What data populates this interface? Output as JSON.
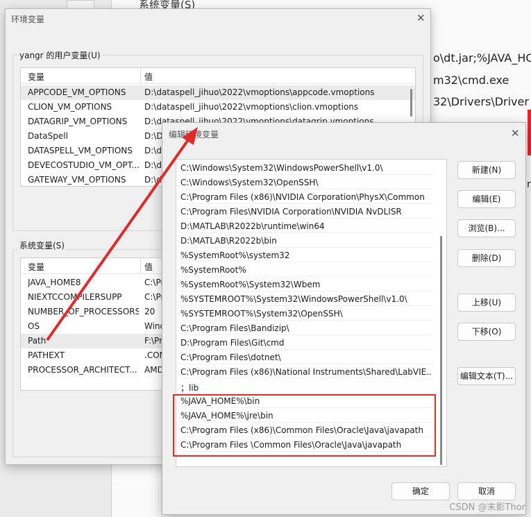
{
  "background": {
    "title": "系统变量(S)",
    "lines": [
      "o\\dt.jar;%JAVA_HO",
      "m32\\cmd.exe",
      "32\\Drivers\\Driver"
    ],
    "side_text": "ru"
  },
  "outer_dialog": {
    "title": "环境变量",
    "user_group_label": "yangr 的用户变量(U)",
    "columns": [
      "变量",
      "值"
    ],
    "user_vars": [
      {
        "name": "APPCODE_VM_OPTIONS",
        "value": "D:\\dataspell_jihuo\\2022\\vmoptions\\appcode.vmoptions"
      },
      {
        "name": "CLION_VM_OPTIONS",
        "value": "D:\\dataspell_jihuo\\2022\\vmoptions\\clion.vmoptions"
      },
      {
        "name": "DATAGRIP_VM_OPTIONS",
        "value": "D:\\dataspell_jihuo\\2022\\vmoptions\\datagrip.vmoptions"
      },
      {
        "name": "DataSpell",
        "value": "D:\\D"
      },
      {
        "name": "DATASPELL_VM_OPTIONS",
        "value": "D:\\d"
      },
      {
        "name": "DEVECOSTUDIO_VM_OPT...",
        "value": "D:\\d"
      },
      {
        "name": "GATEWAY_VM_OPTIONS",
        "value": "D:\\d"
      }
    ],
    "system_group_label": "系统变量(S)",
    "system_vars": [
      {
        "name": "JAVA_HOME8",
        "value": "C:\\Pr"
      },
      {
        "name": "NIEXTCCOMPILERSUPP",
        "value": "C:\\Pr"
      },
      {
        "name": "NUMBER_OF_PROCESSORS",
        "value": "20"
      },
      {
        "name": "OS",
        "value": "Wind"
      },
      {
        "name": "Path",
        "value": "F:\\Pr"
      },
      {
        "name": "PATHEXT",
        "value": ".COM"
      },
      {
        "name": "PROCESSOR_ARCHITECT...",
        "value": "AMD"
      }
    ]
  },
  "inner_dialog": {
    "title": "编辑环境变量",
    "paths": [
      "C:\\Windows\\System32\\WindowsPowerShell\\v1.0\\",
      "C:\\Windows\\System32\\OpenSSH\\",
      "C:\\Program Files (x86)\\NVIDIA Corporation\\PhysX\\Common",
      "C:\\Program Files\\NVIDIA Corporation\\NVIDIA NvDLISR",
      "D:\\MATLAB\\R2022b\\runtime\\win64",
      "D:\\MATLAB\\R2022b\\bin",
      "%SystemRoot%\\system32",
      "%SystemRoot%",
      "%SystemRoot%\\System32\\Wbem",
      "%SYSTEMROOT%\\System32\\WindowsPowerShell\\v1.0\\",
      "%SYSTEMROOT%\\System32\\OpenSSH\\",
      "C:\\Program Files\\Bandizip\\",
      "D:\\Program Files\\Git\\cmd",
      "C:\\Program Files\\dotnet\\",
      "C:\\Program Files (x86)\\National Instruments\\Shared\\LabVIE...",
      "；lib",
      "%JAVA_HOME%\\bin",
      "%JAVA_HOME%\\jre\\bin",
      "C:\\Program Files (x86)\\Common Files\\Oracle\\Java\\javapath",
      "C:\\Program Files \\Common Files\\Oracle\\Java\\javapath"
    ],
    "buttons": {
      "new": "新建(N)",
      "edit": "编辑(E)",
      "browse": "浏览(B)...",
      "delete": "删除(D)",
      "move_up": "上移(U)",
      "move_down": "下移(O)",
      "edit_text": "编辑文本(T)...",
      "ok": "确定",
      "cancel": "取消"
    }
  },
  "watermark": "CSDN @末影Thor",
  "colors": {
    "annotation_red": "#e02b2b"
  }
}
